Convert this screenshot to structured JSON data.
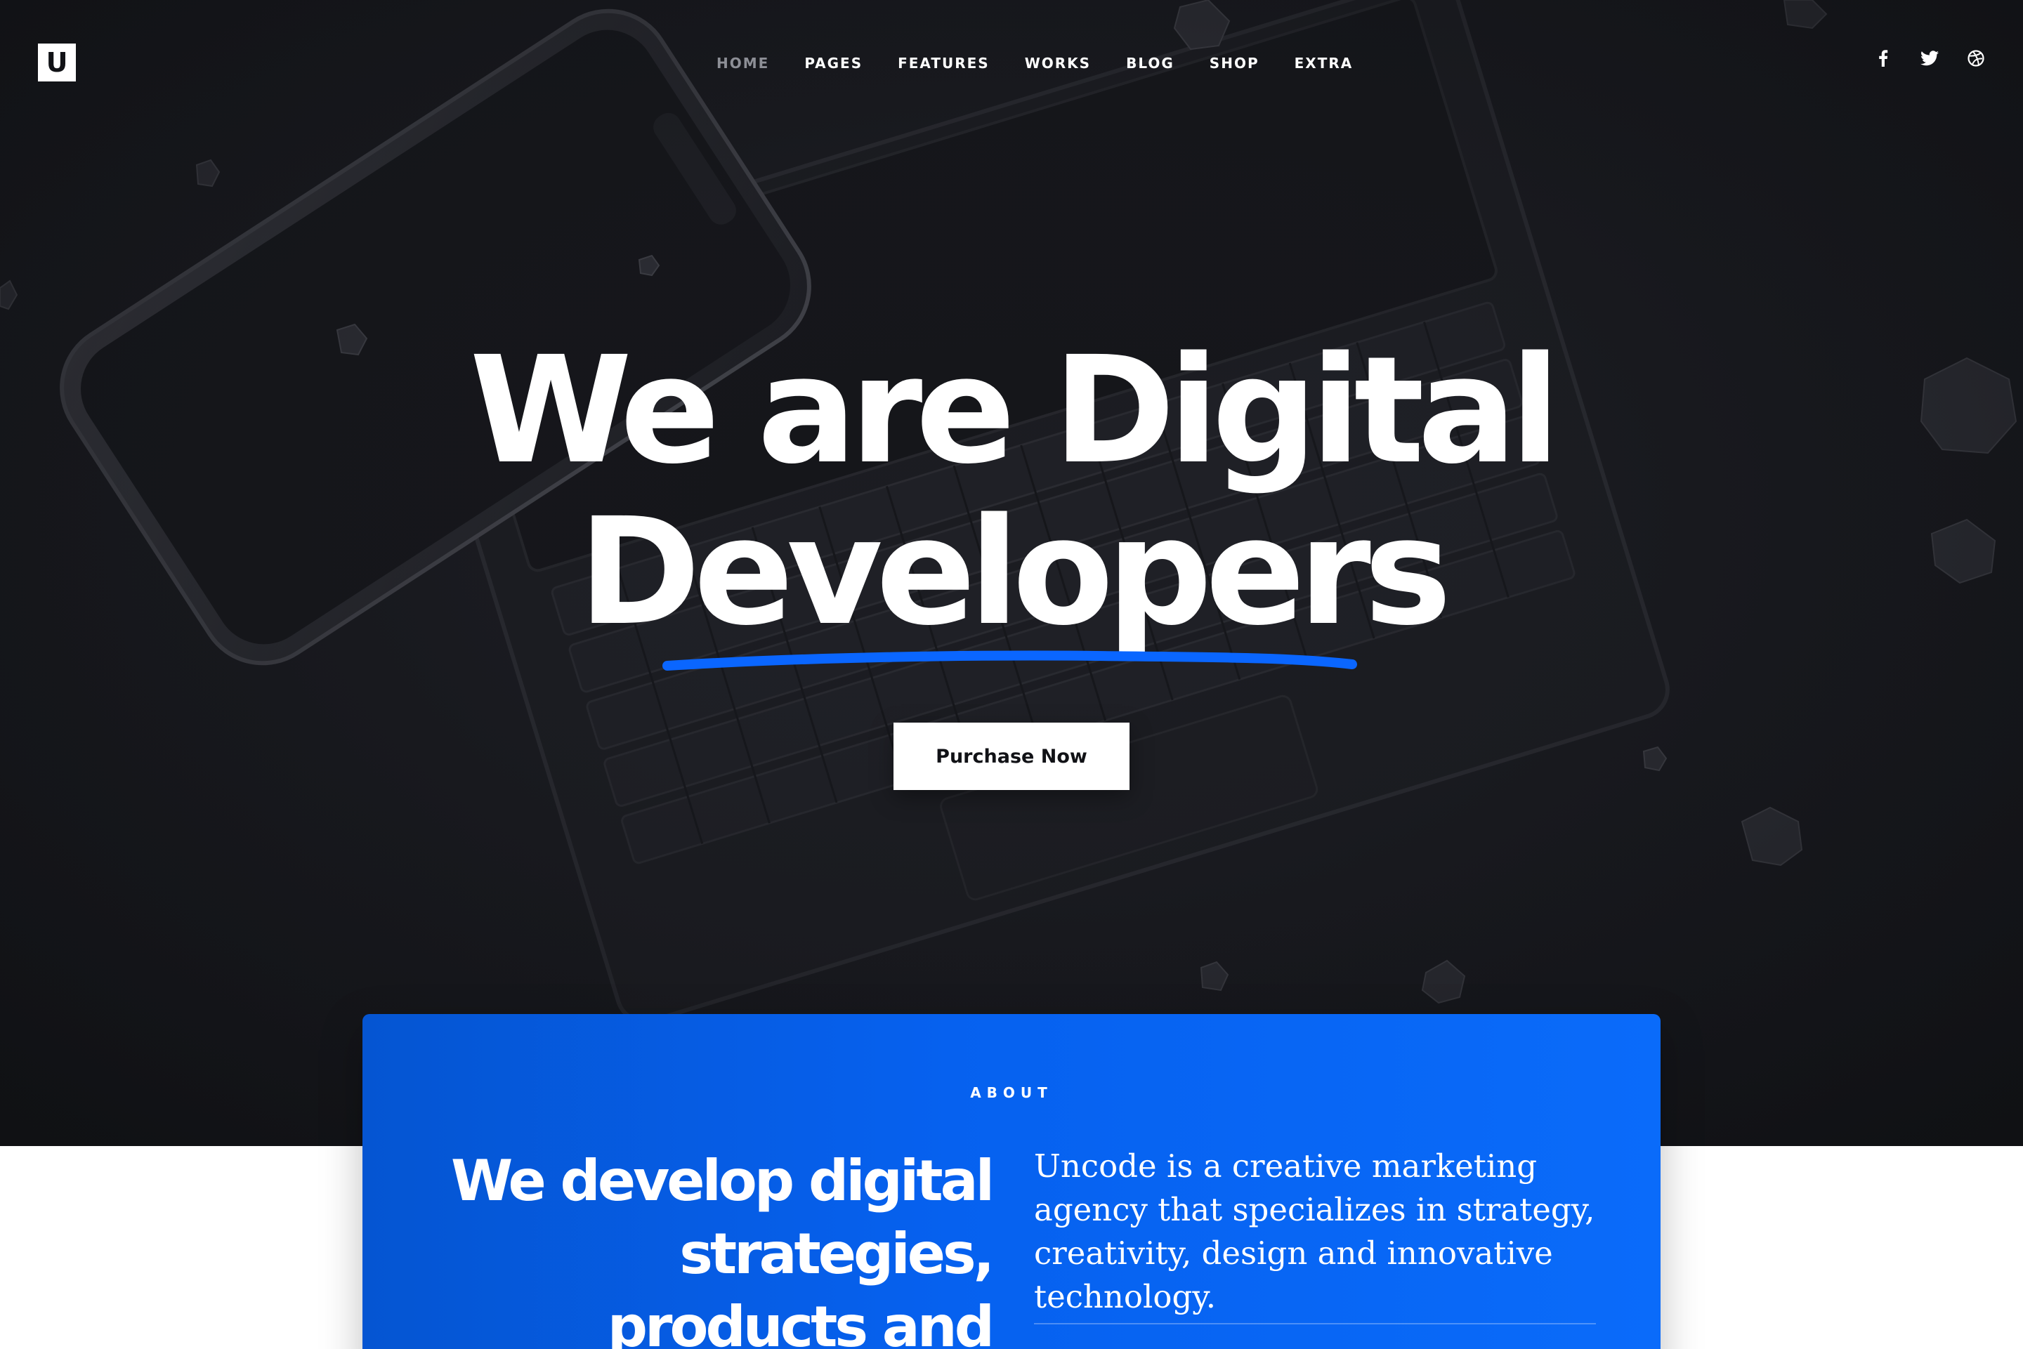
{
  "brand": {
    "logo_letter": "U"
  },
  "nav": {
    "items": [
      {
        "label": "HOME",
        "active": true
      },
      {
        "label": "PAGES",
        "active": false
      },
      {
        "label": "FEATURES",
        "active": false
      },
      {
        "label": "WORKS",
        "active": false
      },
      {
        "label": "BLOG",
        "active": false
      },
      {
        "label": "SHOP",
        "active": false
      },
      {
        "label": "EXTRA",
        "active": false
      }
    ]
  },
  "social": {
    "icons": [
      "facebook-icon",
      "twitter-icon",
      "dribbble-icon"
    ]
  },
  "hero": {
    "title_line_1": "We are Digital",
    "title_line_2": "Developers",
    "cta_label": "Purchase Now"
  },
  "about": {
    "eyebrow": "ABOUT",
    "heading_line_1": "We develop digital",
    "heading_line_2": "strategies,",
    "heading_line_3": "products and",
    "description": "Uncode is a creative marketing agency that specializes in strategy, creativity, design and innovative technology."
  },
  "colors": {
    "hero_background": "#17181d",
    "accent_blue": "#0661ef",
    "underline_blue": "#0a66ff",
    "text_white": "#ffffff",
    "nav_active": "#8d8f96"
  }
}
